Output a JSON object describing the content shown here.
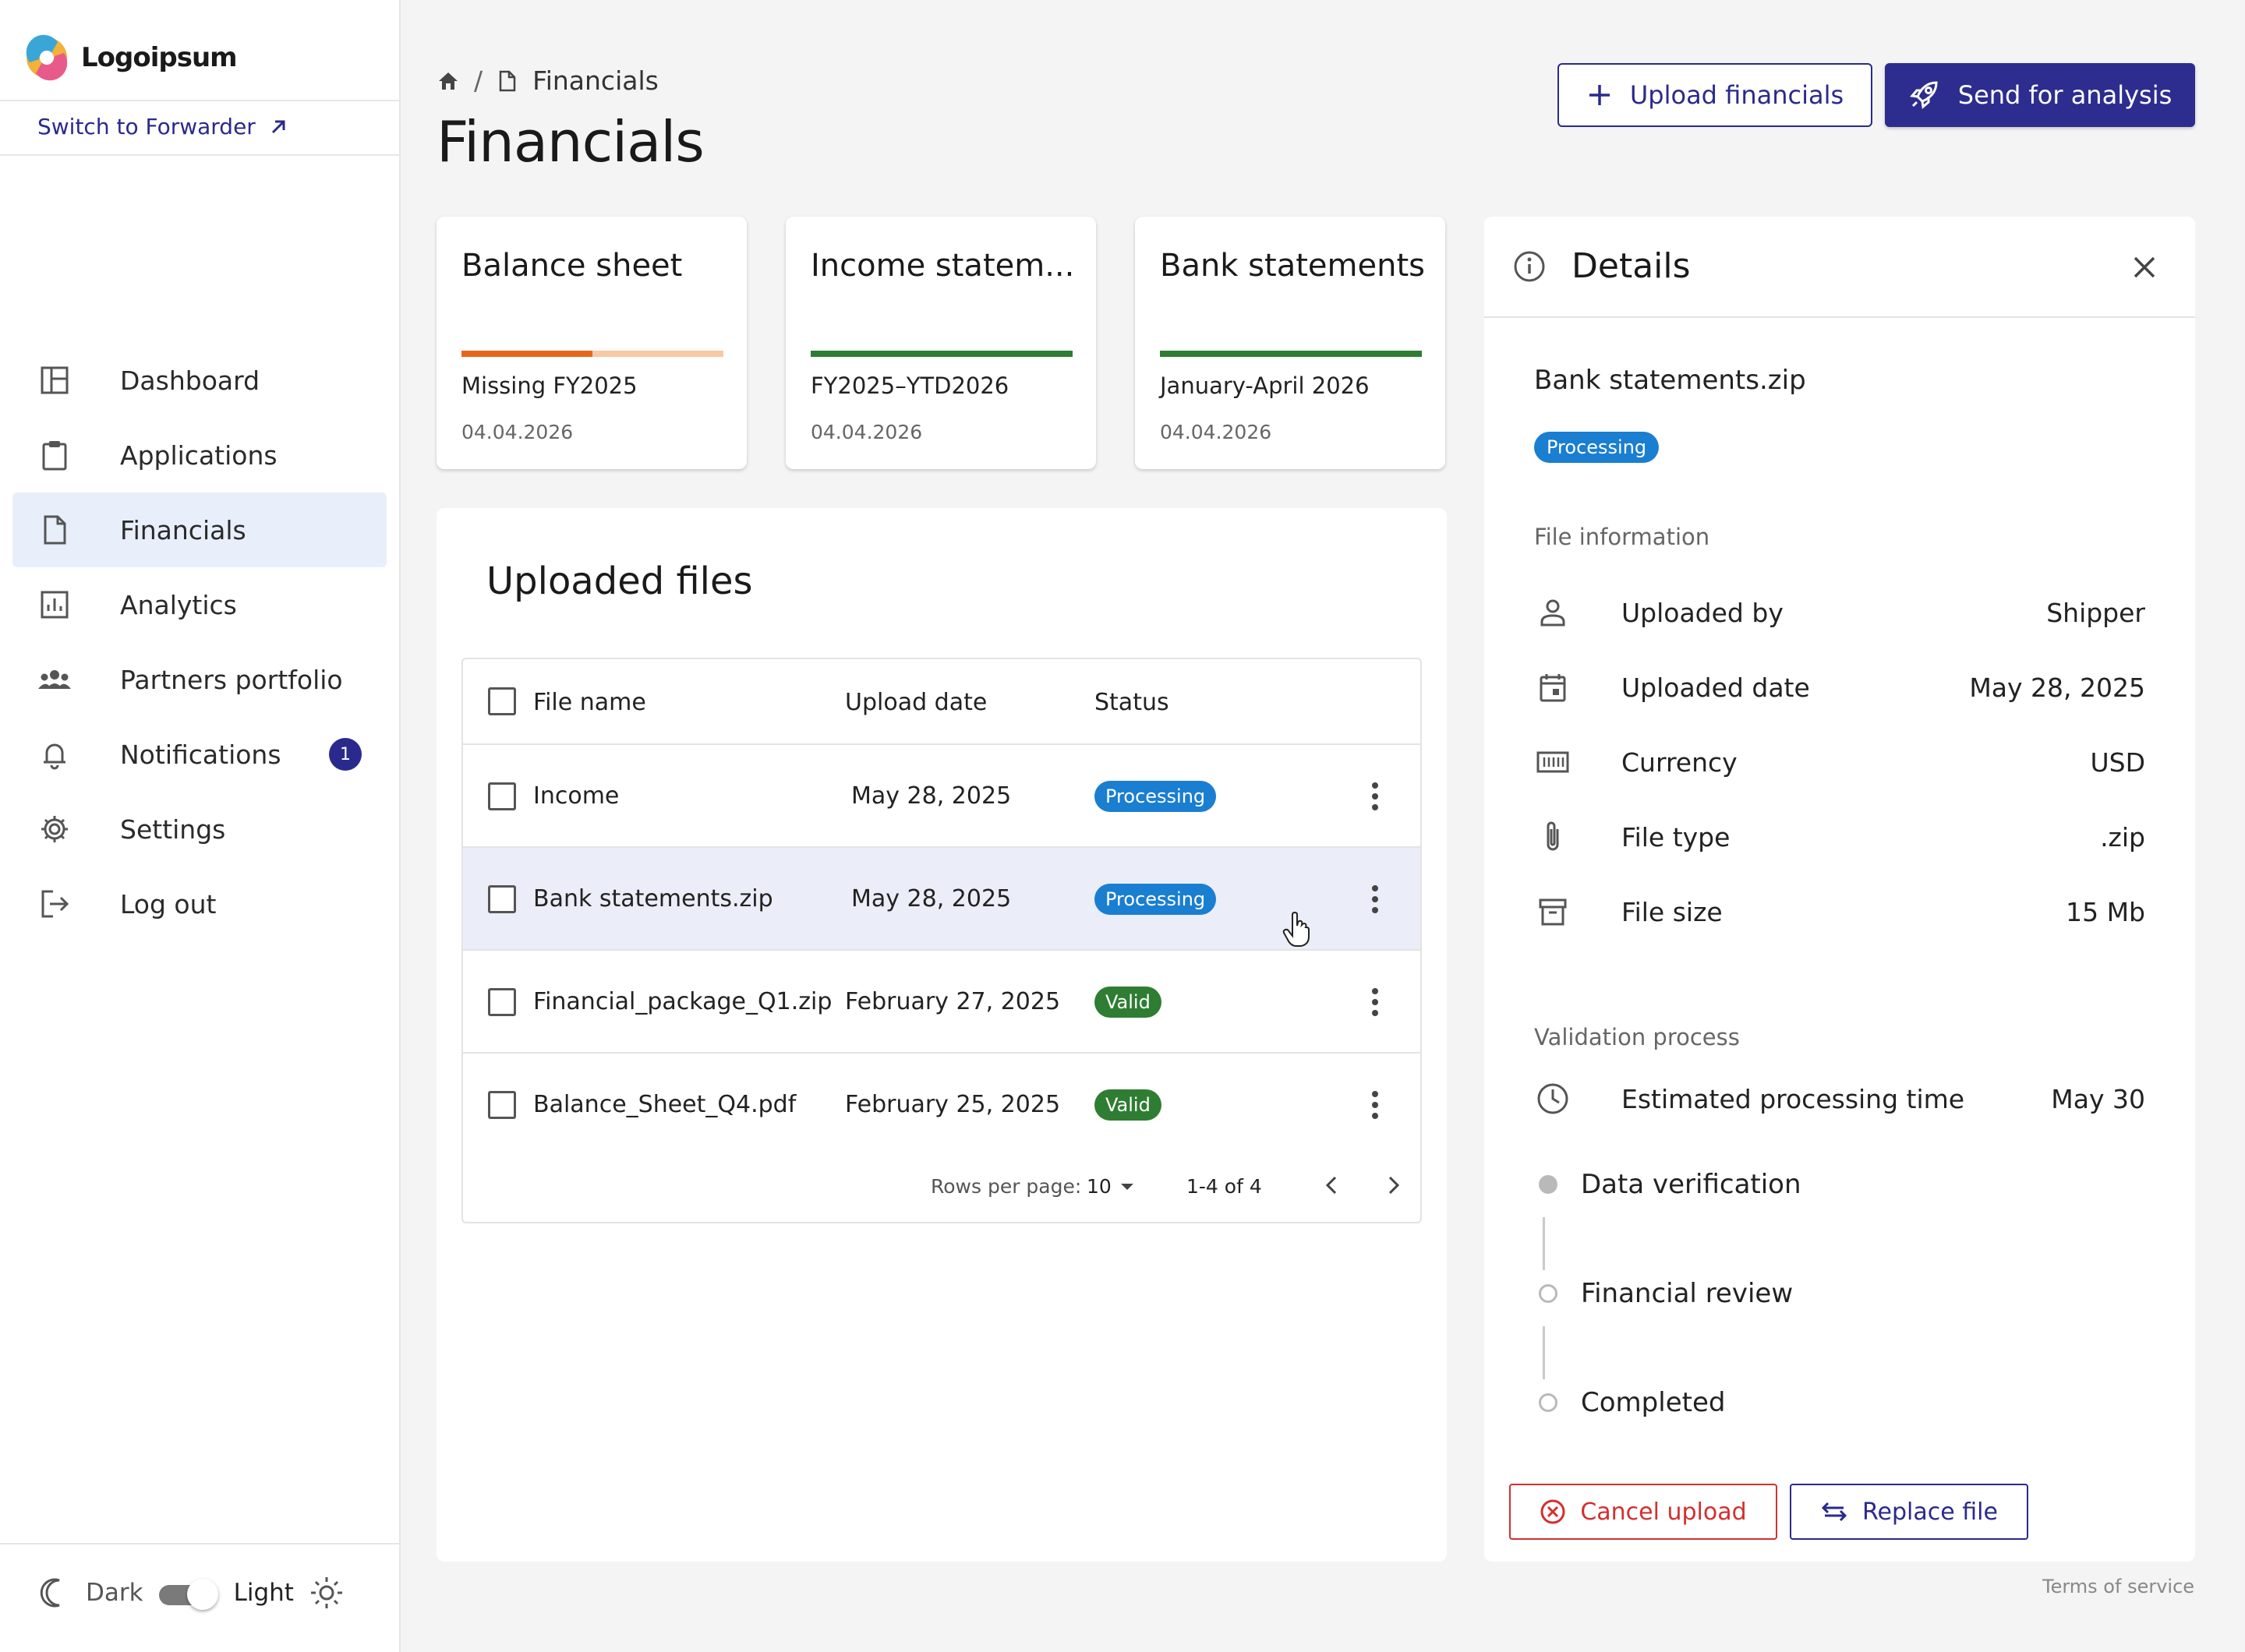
{
  "brand": {
    "name": "Logoipsum"
  },
  "sidebar": {
    "switch_link": "Switch to Forwarder",
    "items": [
      {
        "label": "Dashboard",
        "icon": "dashboard-icon"
      },
      {
        "label": "Applications",
        "icon": "clipboard-icon"
      },
      {
        "label": "Financials",
        "icon": "document-icon",
        "active": true
      },
      {
        "label": "Analytics",
        "icon": "bar-chart-icon"
      },
      {
        "label": "Partners portfolio",
        "icon": "group-icon"
      },
      {
        "label": "Notifications",
        "icon": "bell-icon",
        "badge": "1"
      },
      {
        "label": "Settings",
        "icon": "gear-icon"
      },
      {
        "label": "Log out",
        "icon": "logout-icon"
      }
    ],
    "theme": {
      "dark_label": "Dark",
      "light_label": "Light",
      "mode": "light"
    }
  },
  "header": {
    "breadcrumb_current": "Financials",
    "title": "Financials",
    "upload_label": "Upload financials",
    "send_label": "Send for analysis"
  },
  "cards": [
    {
      "title": "Balance sheet",
      "status": "Missing FY2025",
      "date": "04.04.2026",
      "progress": 0.5,
      "color": "#e8661c"
    },
    {
      "title": "Income statem...",
      "status": "FY2025–YTD2026",
      "date": "04.04.2026",
      "progress": 1.0,
      "color": "#2e7d32"
    },
    {
      "title": "Bank statements",
      "status": "January-April 2026",
      "date": "04.04.2026",
      "progress": 1.0,
      "color": "#2e7d32"
    }
  ],
  "files": {
    "title": "Uploaded files",
    "columns": [
      "File name",
      "Upload date",
      "Status"
    ],
    "rows": [
      {
        "name": "Income",
        "date": "May 28, 2025",
        "status": "Processing"
      },
      {
        "name": "Bank statements.zip",
        "date": "May 28, 2025",
        "status": "Processing"
      },
      {
        "name": "Financial_package_Q1.zip",
        "date": "February 27, 2025",
        "status": "Valid"
      },
      {
        "name": "Balance_Sheet_Q4.pdf",
        "date": "February 25, 2025",
        "status": "Valid"
      }
    ],
    "rows_per_page_label": "Rows per page:",
    "rows_per_page": "10",
    "range": "1-4 of 4"
  },
  "details": {
    "title": "Details",
    "file_name": "Bank statements.zip",
    "status": "Processing",
    "file_info_title": "File information",
    "info": [
      {
        "label": "Uploaded by",
        "value": "Shipper",
        "icon": "person-icon"
      },
      {
        "label": "Uploaded date",
        "value": "May 28, 2025",
        "icon": "calendar-icon"
      },
      {
        "label": "Currency",
        "value": "USD",
        "icon": "currency-icon"
      },
      {
        "label": "File type",
        "value": ".zip",
        "icon": "paperclip-icon"
      },
      {
        "label": "File size",
        "value": "15 Mb",
        "icon": "archive-icon"
      }
    ],
    "validation_title": "Validation process",
    "estimate_label": "Estimated processing time",
    "estimate_value": "May 30",
    "steps": [
      {
        "label": "Data verification",
        "state": "done"
      },
      {
        "label": "Financial review",
        "state": "todo"
      },
      {
        "label": "Completed",
        "state": "todo"
      }
    ],
    "cancel_label": "Cancel upload",
    "replace_label": "Replace file"
  },
  "footer": {
    "terms": "Terms of service"
  },
  "colors": {
    "primary": "#2d2d8f",
    "processing": "#1a7ed1",
    "valid": "#2e7d32",
    "danger": "#d32f2f",
    "warning": "#e8661c"
  }
}
